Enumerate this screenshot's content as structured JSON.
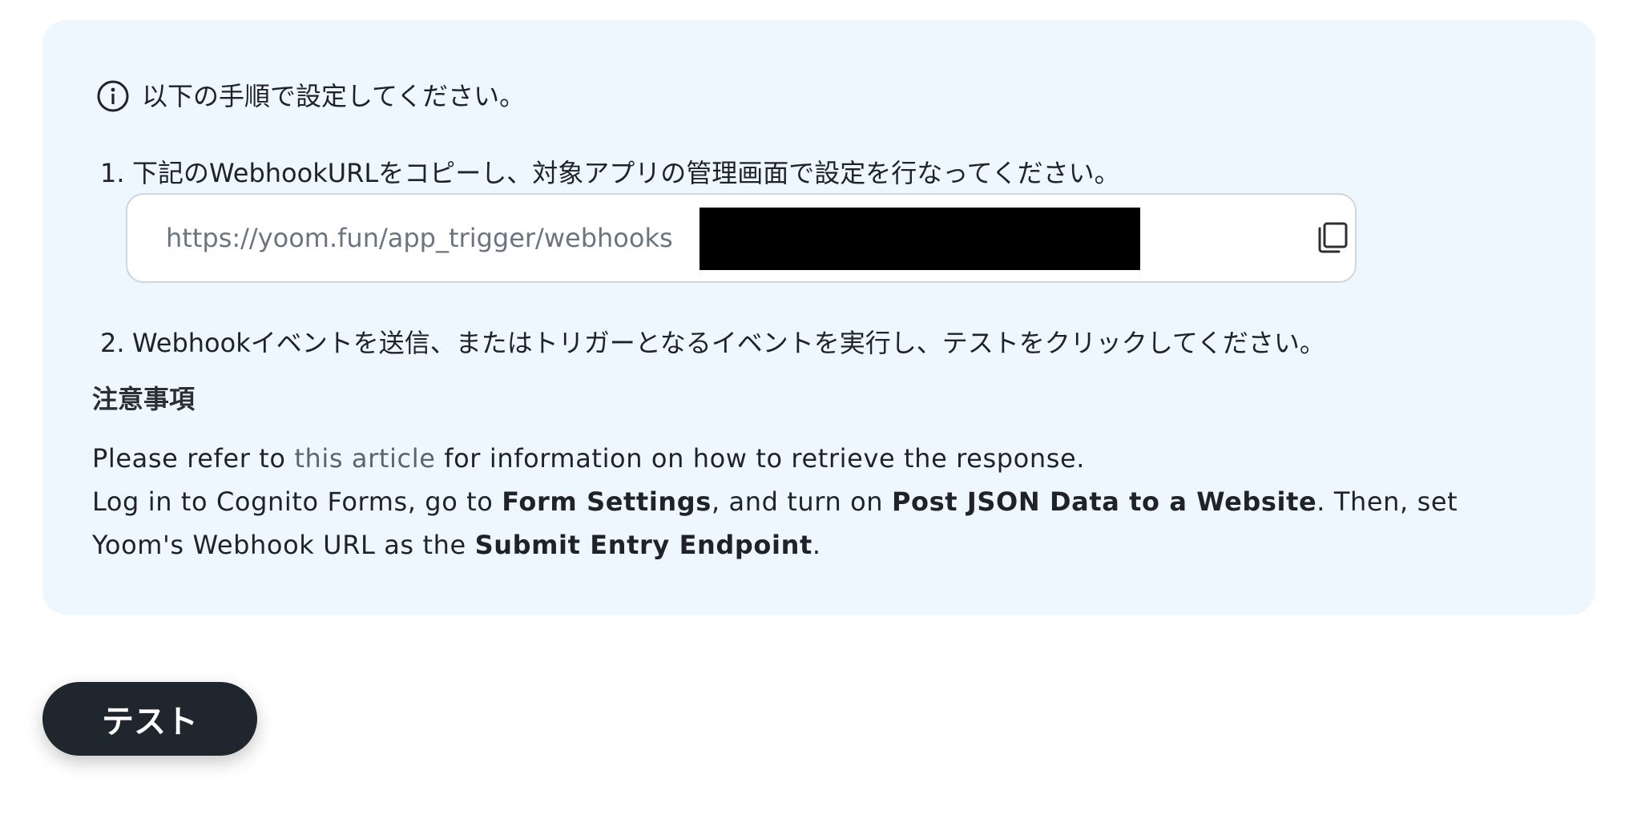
{
  "instructions": {
    "intro": "以下の手順で設定してください。",
    "step1_num": "1.",
    "step1_text": "下記のWebhookURLをコピーし、対象アプリの管理画面で設定を行なってください。",
    "webhook_url_visible": "https://yoom.fun/app_trigger/webhooks",
    "step2_num": "2.",
    "step2_text": "Webhookイベントを送信、またはトリガーとなるイベントを実行し、テストをクリックしてください。"
  },
  "caution": {
    "heading": "注意事項",
    "line1_pre": "Please refer to ",
    "line1_link": "this article",
    "line1_post": " for information on how to retrieve the response.",
    "line2_a": "Log in to Cognito Forms, go to ",
    "line2_b": "Form Settings",
    "line2_c": ", and turn on ",
    "line2_d": "Post JSON Data to a Website",
    "line2_e": ". Then, set Yoom's Webhook URL as the ",
    "line2_f": "Submit Entry Endpoint",
    "line2_g": "."
  },
  "actions": {
    "test_label": "テスト"
  },
  "icons": {
    "info": "info-icon",
    "copy": "copy-icon"
  },
  "colors": {
    "panel_bg": "#eef6fe",
    "button_bg": "#20262d",
    "link": "#5a6472"
  }
}
